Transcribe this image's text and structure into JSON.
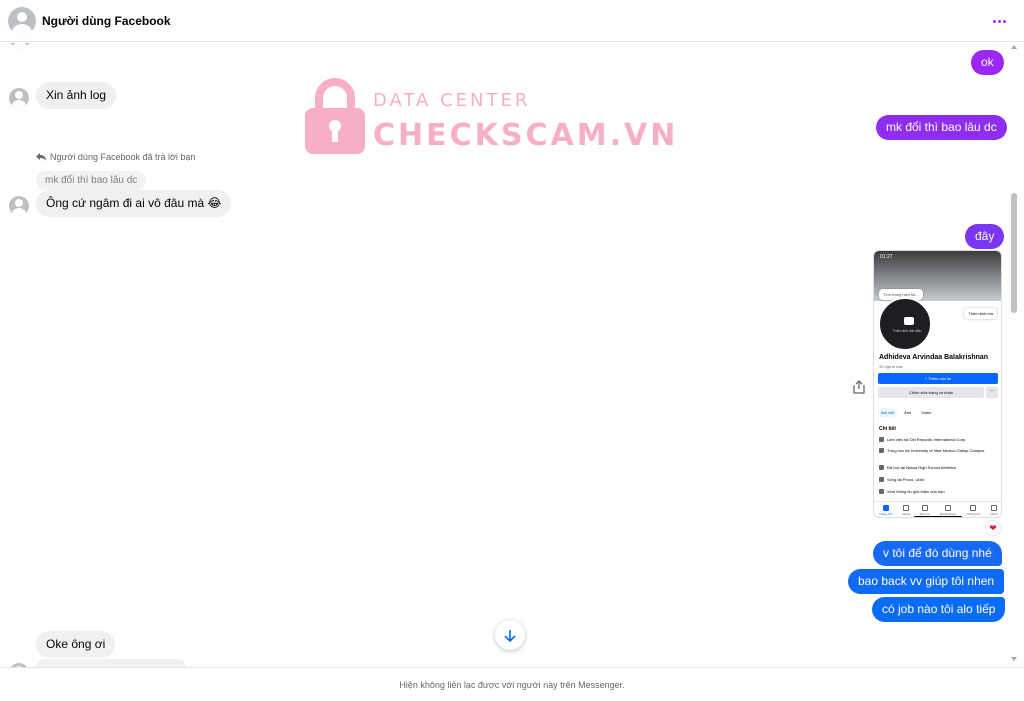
{
  "header": {
    "title": "Người dùng Facebook",
    "more_icon": "more-dots-icon",
    "accent": "#a033ff"
  },
  "watermark": {
    "line1": "DATA CENTER",
    "line2": "CHECKSCAM.VN",
    "color": "#ef4f82"
  },
  "messages": {
    "out_ok": "ok",
    "in_xin_anh_log": "Xin ảnh log",
    "out_mk_doi": "mk đổi thì bao lâu dc",
    "reply_note": "Người dùng Facebook đã trả lời bạn",
    "quoted": "mk đổi thì bao lâu dc",
    "in_ong_cu": "Ông cứ ngâm đi ai vô đâu mà 😂",
    "out_day": "đây",
    "out_v_toi": "v tôi để đó dùng nhé",
    "out_bao_back": "bao back vv giúp tôi nhen",
    "out_co_job": "có job nào tôi alo tiếp",
    "in_oke": "Oke ông ơi",
    "reaction": "❤"
  },
  "colors": {
    "purple": "#9b27f4",
    "violet": "#6b3cf0",
    "blue": "#0a6cf5",
    "incoming": "#f0f0f0"
  },
  "screenshot": {
    "time": "01:27",
    "tooltip": "Tình trạng hiện tại...",
    "add_cover": "Thêm ảnh bìa",
    "avatar_caption": "Thêm ảnh đại diện",
    "name": "Adhideva Arvindaa Balakrishnan",
    "friends": "33 người bạn",
    "add_story": "+ Thêm vào tin",
    "edit_profile": "Chỉnh sửa trang cá nhân",
    "more": "···",
    "tabs": [
      "Bài viết",
      "Ảnh",
      "Video"
    ],
    "section": "Chi tiết",
    "details": [
      "Làm việc tại Old Republic International Corp.",
      "Từng học tại University of New Mexico-Gallup Campus",
      "Đã học tại Nyssa High School Athletics",
      "Sống tại Provo, Utah",
      "Xem thông tin giới thiệu của bạn"
    ],
    "nav": [
      "Trang chủ",
      "Reels",
      "Bạn bè",
      "Marketplace",
      "Thông báo",
      "Menu"
    ]
  },
  "footer": {
    "notice": "Hiện không liên lạc được với người này trên Messenger."
  }
}
